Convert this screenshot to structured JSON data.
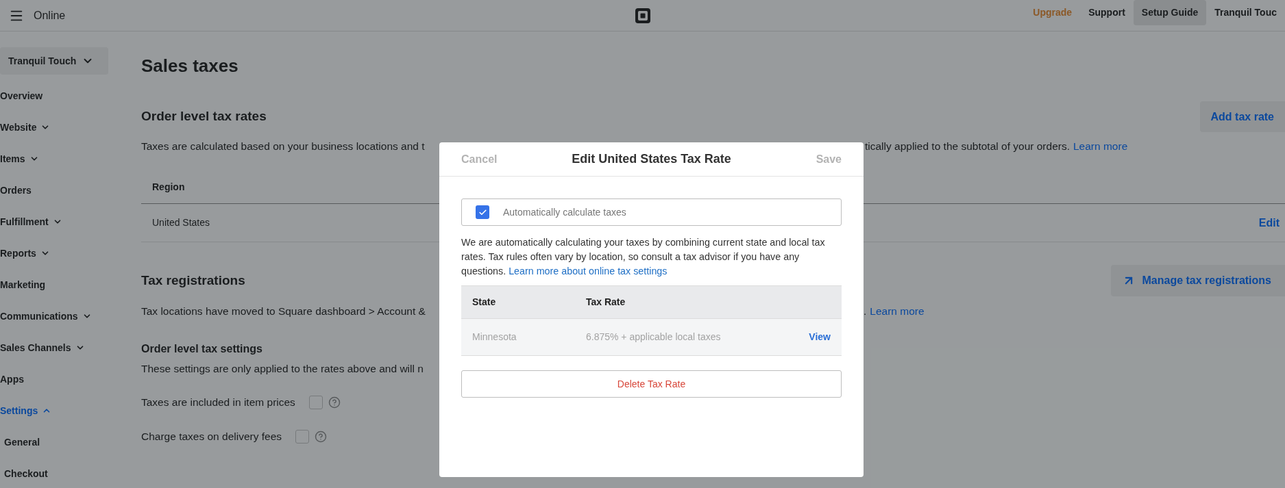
{
  "header": {
    "app_label": "Online",
    "links": [
      {
        "label": "Upgrade",
        "kind": "upgrade"
      },
      {
        "label": "Support",
        "kind": "plain"
      },
      {
        "label": "Setup Guide",
        "kind": "highlighted"
      },
      {
        "label": "Tranquil Touc",
        "kind": "plain"
      }
    ]
  },
  "sidebar": {
    "location": "Tranquil Touch",
    "items": [
      {
        "label": "Overview",
        "kind": "link",
        "selected": false
      },
      {
        "label": "Website",
        "kind": "group",
        "expanded": false,
        "selected": false
      },
      {
        "label": "Items",
        "kind": "group",
        "expanded": false,
        "selected": false
      },
      {
        "label": "Orders",
        "kind": "link",
        "selected": false
      },
      {
        "label": "Fulfillment",
        "kind": "group",
        "expanded": false,
        "selected": false
      },
      {
        "label": "Reports",
        "kind": "group",
        "expanded": false,
        "selected": false
      },
      {
        "label": "Marketing",
        "kind": "link",
        "selected": false
      },
      {
        "label": "Communications",
        "kind": "group",
        "expanded": false,
        "selected": false
      },
      {
        "label": "Sales Channels",
        "kind": "group",
        "expanded": false,
        "selected": false
      },
      {
        "label": "Apps",
        "kind": "link",
        "selected": false
      },
      {
        "label": "Settings",
        "kind": "group",
        "expanded": true,
        "selected": true,
        "children": [
          {
            "label": "General",
            "selected": false
          },
          {
            "label": "Checkout",
            "selected": false
          }
        ]
      }
    ]
  },
  "page": {
    "title": "Sales taxes",
    "order_level_tax_rates": {
      "heading": "Order level tax rates",
      "add_button": "Add tax rate",
      "description_left": "Taxes are calculated based on your business locations and t",
      "description_right": "tically applied to the subtotal of your orders.",
      "learn_more": "Learn more",
      "table": {
        "columns": [
          "Region"
        ],
        "rows": [
          {
            "region": "United States",
            "action": "Edit"
          }
        ]
      }
    },
    "tax_registrations": {
      "heading": "Tax registrations",
      "manage_button": "Manage tax registrations",
      "description_left": "Tax locations have moved to Square dashboard > Account &",
      "description_right": ".",
      "learn_more": "Learn more"
    },
    "order_level_tax_settings": {
      "heading": "Order level tax settings",
      "description": "These settings are only applied to the rates above and will n",
      "options": [
        {
          "label": "Taxes are included in item prices",
          "checked": false
        },
        {
          "label": "Charge taxes on delivery fees",
          "checked": false
        }
      ]
    }
  },
  "dialog": {
    "title": "Edit United States Tax Rate",
    "cancel": "Cancel",
    "save": "Save",
    "auto_calculate": {
      "label": "Automatically calculate taxes",
      "checked": true
    },
    "info": "We are automatically calculating your taxes by combining current state and local tax rates. Tax rules often vary by location, so consult a tax advisor if you have any questions.",
    "info_link": "Learn more about online tax settings",
    "table": {
      "columns": [
        "State",
        "Tax Rate"
      ],
      "rows": [
        {
          "state": "Minnesota",
          "tax_rate": "6.875% + applicable local taxes",
          "action": "View"
        }
      ]
    },
    "delete_button": "Delete Tax Rate"
  }
}
